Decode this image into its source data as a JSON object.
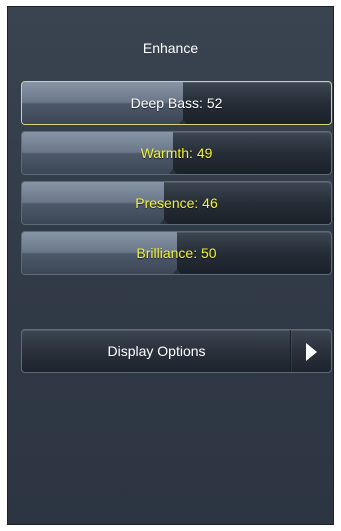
{
  "title": "Enhance",
  "sliders": [
    {
      "label": "Deep Bass: 52",
      "value": 52,
      "selected": true
    },
    {
      "label": "Warmth: 49",
      "value": 49,
      "selected": false
    },
    {
      "label": "Presence: 46",
      "value": 46,
      "selected": false
    },
    {
      "label": "Brilliance: 50",
      "value": 50,
      "selected": false
    }
  ],
  "slider_range": [
    0,
    100
  ],
  "display_options": {
    "label": "Display Options",
    "icon": "chevron-right-icon"
  },
  "colors": {
    "label_normal": "#f2f238",
    "label_selected": "#ffffff",
    "selected_border": "#d9d27a"
  }
}
